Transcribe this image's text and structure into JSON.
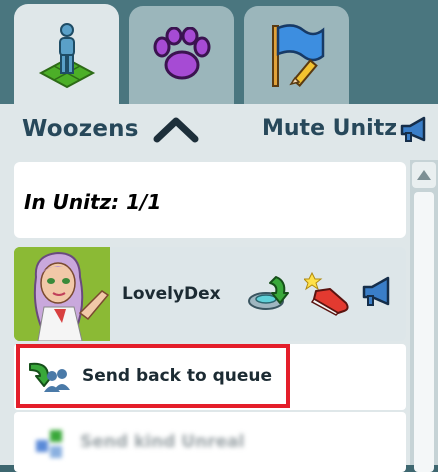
{
  "tabs": [
    {
      "name": "players",
      "icon": "player-on-tile-icon",
      "active": true
    },
    {
      "name": "pets",
      "icon": "paw-icon",
      "active": false
    },
    {
      "name": "flag",
      "icon": "flag-pencil-icon",
      "active": false
    }
  ],
  "header": {
    "title": "Woozens",
    "mute_label": "Mute Unitz"
  },
  "list": {
    "count_label": "In Unitz: 1/1",
    "user": {
      "name": "LovelyDex"
    },
    "send_back_label": "Send back to queue",
    "blurred_label": "Send kind Unreal"
  },
  "colors": {
    "highlight": "#e41e2a",
    "header_text": "#27485a",
    "avatar_bg": "#8bba35"
  }
}
